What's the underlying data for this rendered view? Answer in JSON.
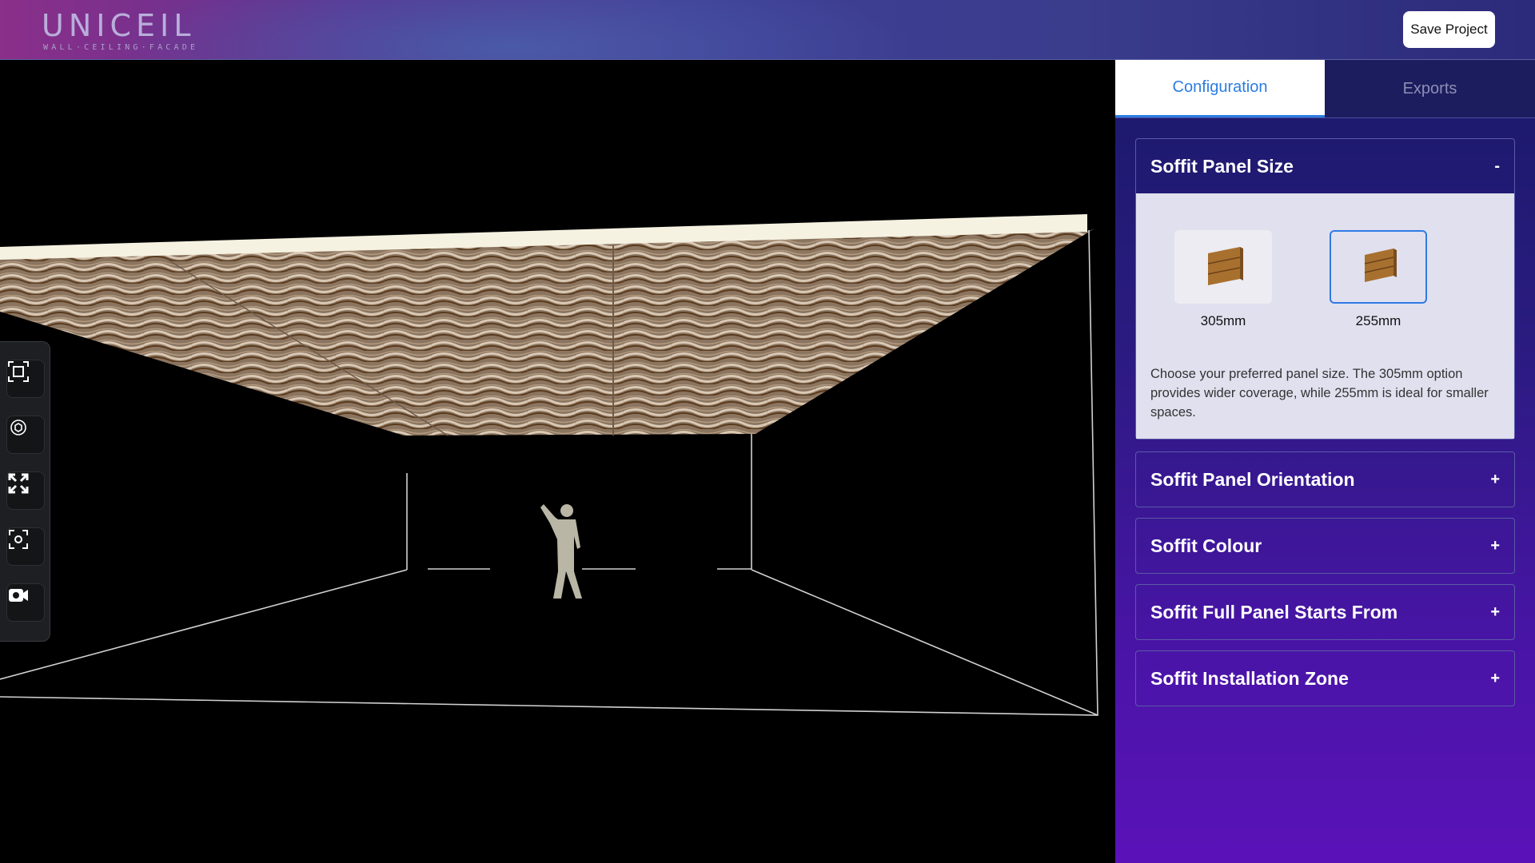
{
  "header": {
    "logo_word": "UNICEIL",
    "logo_tagline": "WALL·CEILING·FACADE",
    "save_label": "Save Project"
  },
  "tabs": [
    {
      "label": "Configuration",
      "active": true
    },
    {
      "label": "Exports",
      "active": false
    }
  ],
  "sections": [
    {
      "title": "Soffit Panel Size",
      "expanded": true,
      "toggle": "-",
      "options": [
        {
          "label": "305mm",
          "selected": false
        },
        {
          "label": "255mm",
          "selected": true
        }
      ],
      "description": "Choose your preferred panel size. The 305mm option provides wider coverage, while 255mm is ideal for smaller spaces."
    },
    {
      "title": "Soffit Panel Orientation",
      "expanded": false,
      "toggle": "+"
    },
    {
      "title": "Soffit Colour",
      "expanded": false,
      "toggle": "+"
    },
    {
      "title": "Soffit Full Panel Starts From",
      "expanded": false,
      "toggle": "+"
    },
    {
      "title": "Soffit Installation Zone",
      "expanded": false,
      "toggle": "+"
    }
  ],
  "toolbar": {
    "tools": [
      "frame-icon",
      "rotate-icon",
      "fullscreen-icon",
      "focus-icon",
      "camera-icon"
    ]
  },
  "colors": {
    "accent": "#2b7de0",
    "panel_top": "#1a1a6a",
    "panel_bottom": "#5a12b8",
    "wood": "#a8702f"
  }
}
